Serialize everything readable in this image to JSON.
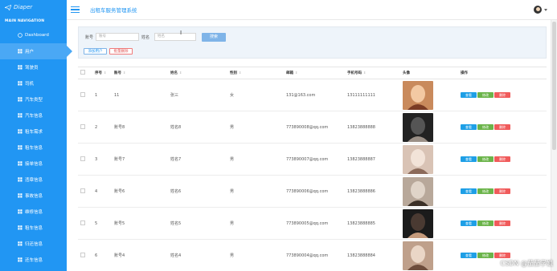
{
  "sidebar": {
    "logo_text": "Diaper",
    "nav_title": "MAIN NAVIGATION",
    "items": [
      {
        "label": "Dashboard",
        "icon": "dashboard-icon",
        "active": false
      },
      {
        "label": "用户",
        "icon": "grid-icon",
        "active": true
      },
      {
        "label": "驾驶员",
        "icon": "grid-icon",
        "active": false
      },
      {
        "label": "司机",
        "icon": "grid-icon",
        "active": false
      },
      {
        "label": "汽车类型",
        "icon": "grid-icon",
        "active": false
      },
      {
        "label": "汽车信息",
        "icon": "grid-icon",
        "active": false
      },
      {
        "label": "租车需求",
        "icon": "grid-icon",
        "active": false
      },
      {
        "label": "租车信息",
        "icon": "grid-icon",
        "active": false
      },
      {
        "label": "接单信息",
        "icon": "grid-icon",
        "active": false
      },
      {
        "label": "违章信息",
        "icon": "grid-icon",
        "active": false
      },
      {
        "label": "事故信息",
        "icon": "grid-icon",
        "active": false
      },
      {
        "label": "维修信息",
        "icon": "grid-icon",
        "active": false
      },
      {
        "label": "租车信息",
        "icon": "grid-icon",
        "active": false
      },
      {
        "label": "归还信息",
        "icon": "grid-icon",
        "active": false
      },
      {
        "label": "还车信息",
        "icon": "grid-icon",
        "active": false
      }
    ]
  },
  "header": {
    "title": "出租车服务管理系统"
  },
  "search": {
    "account_label": "账号",
    "account_placeholder": "账号",
    "name_label": "姓名",
    "name_placeholder": "姓名",
    "search_button": "搜索",
    "add_button": "添加用户",
    "batch_delete_button": "批量删除"
  },
  "table": {
    "columns": [
      "",
      "序号",
      "账号",
      "姓名",
      "性别",
      "邮箱",
      "手机号码",
      "头像",
      "操作"
    ],
    "rows": [
      {
        "index": "1",
        "account": "11",
        "name": "张三",
        "gender": "女",
        "email": "131@163.com",
        "phone": "13111111111"
      },
      {
        "index": "2",
        "account": "账号8",
        "name": "姓名8",
        "gender": "男",
        "email": "773890008@qq.com",
        "phone": "13823888888"
      },
      {
        "index": "3",
        "account": "账号7",
        "name": "姓名7",
        "gender": "男",
        "email": "773890007@qq.com",
        "phone": "13823888887"
      },
      {
        "index": "4",
        "account": "账号6",
        "name": "姓名6",
        "gender": "男",
        "email": "773890006@qq.com",
        "phone": "13823888886"
      },
      {
        "index": "5",
        "account": "账号5",
        "name": "姓名5",
        "gender": "男",
        "email": "773890005@qq.com",
        "phone": "13823888885"
      },
      {
        "index": "6",
        "account": "账号4",
        "name": "姓名4",
        "gender": "男",
        "email": "773890004@qq.com",
        "phone": "13823888884"
      }
    ],
    "actions": {
      "view": "查看",
      "edit": "修改",
      "delete": "删除"
    }
  },
  "watermark": "CSDN @茄茄学姐",
  "colors": {
    "sidebar": "#2196f3",
    "accent": "#2196f3",
    "danger": "#f05b5b",
    "success": "#6bb44a"
  }
}
